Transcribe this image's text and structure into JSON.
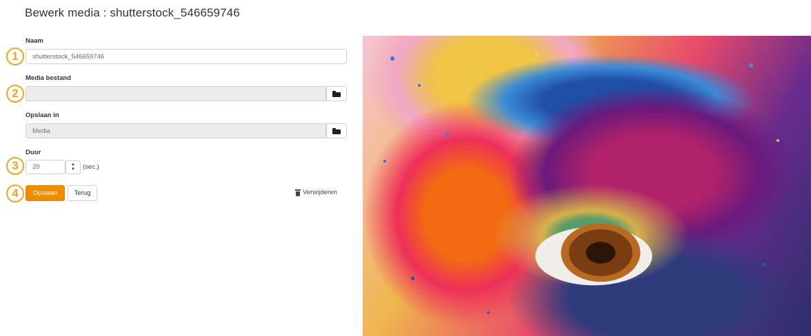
{
  "page": {
    "title": "Bewerk media : shutterstock_546659746"
  },
  "form": {
    "name_label": "Naam",
    "name_value": "shutterstock_546659746",
    "media_file_label": "Media bestand",
    "media_file_value": "",
    "save_in_label": "Opslaan in",
    "save_in_value": "Media",
    "duration_label": "Duur",
    "duration_value": "20",
    "duration_unit": "(sec.)",
    "save_button": "Opslaan",
    "back_button": "Terug",
    "delete_link": "Verwijderen"
  },
  "steps": [
    "1",
    "2",
    "3",
    "4"
  ],
  "icons": {
    "browse": "folder-icon",
    "delete": "trash-icon",
    "spinner": "up-down-arrow-icon"
  },
  "colors": {
    "accent": "#f08c00",
    "step_circle": "#f0a31e"
  }
}
